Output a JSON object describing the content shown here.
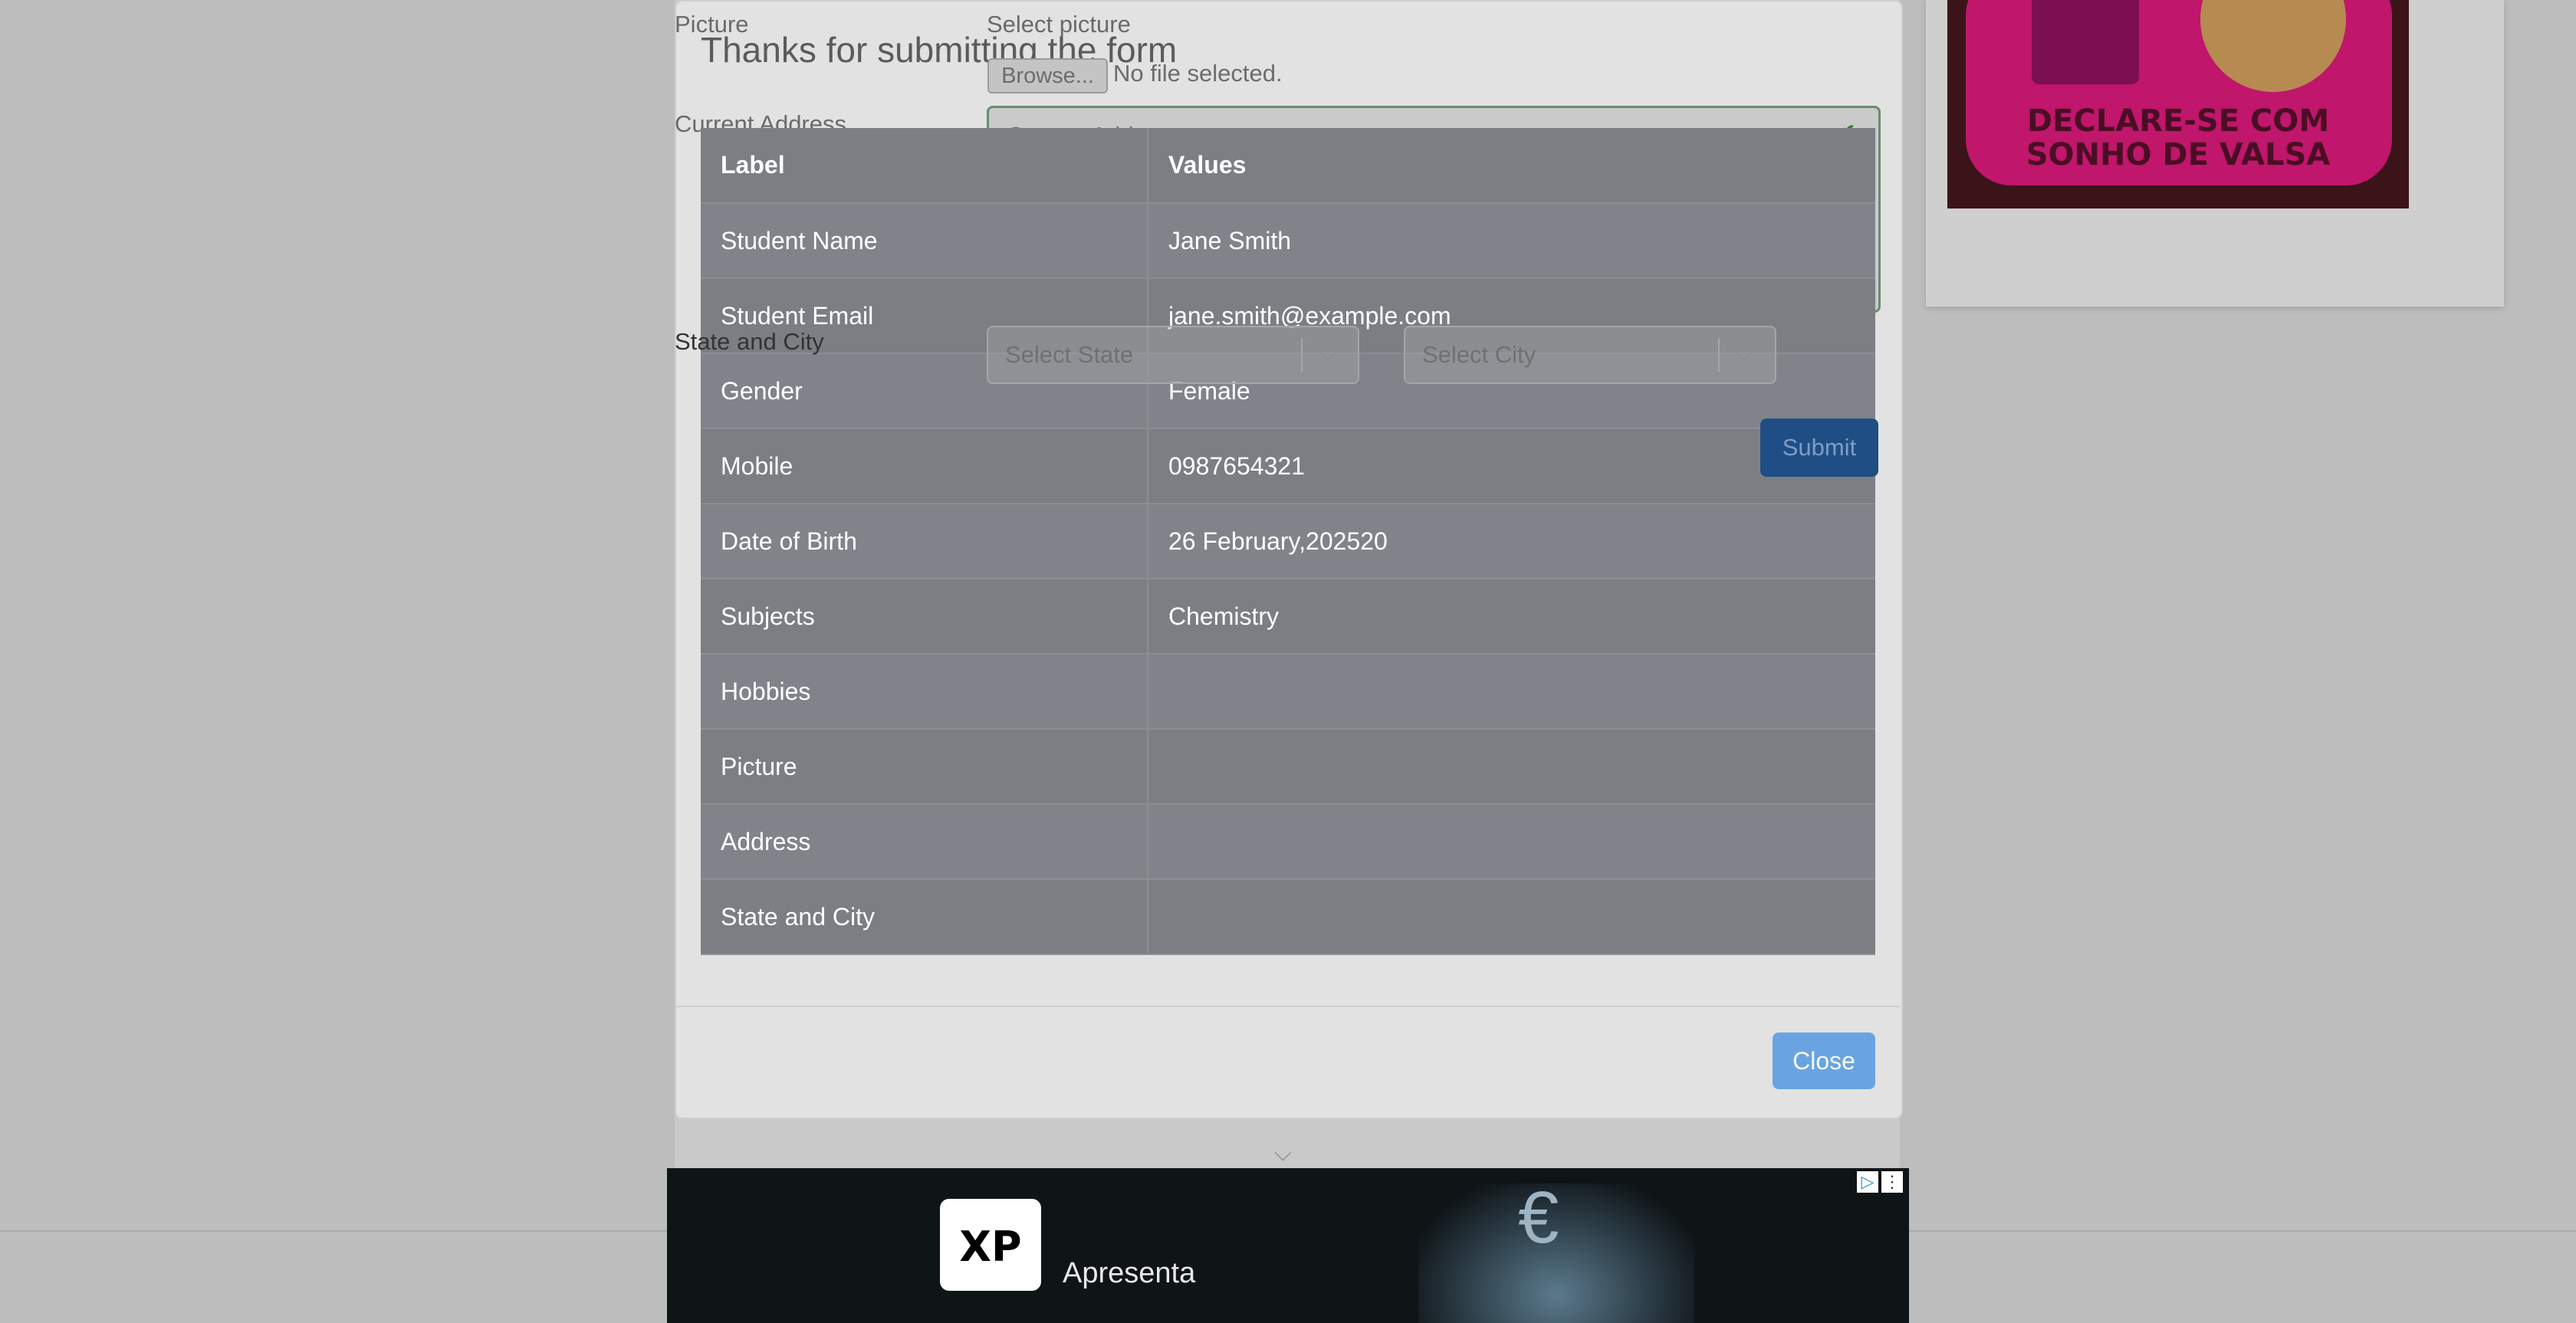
{
  "form": {
    "picture_label": "Picture",
    "select_picture_label": "Select picture",
    "browse_label": "Browse...",
    "file_status": "No file selected.",
    "current_address_label": "Current Address",
    "current_address_placeholder": "Current Address",
    "state_city_label": "State and City",
    "state_placeholder": "Select State",
    "city_placeholder": "Select City",
    "submit_label": "Submit"
  },
  "modal": {
    "title": "Thanks for submitting the form",
    "table": {
      "headers": [
        "Label",
        "Values"
      ],
      "rows": [
        {
          "label": "Student Name",
          "value": "Jane Smith"
        },
        {
          "label": "Student Email",
          "value": "jane.smith@example.com"
        },
        {
          "label": "Gender",
          "value": "Female"
        },
        {
          "label": "Mobile",
          "value": "0987654321"
        },
        {
          "label": "Date of Birth",
          "value": "26 February,202520"
        },
        {
          "label": "Subjects",
          "value": "Chemistry"
        },
        {
          "label": "Hobbies",
          "value": ""
        },
        {
          "label": "Picture",
          "value": ""
        },
        {
          "label": "Address",
          "value": ""
        },
        {
          "label": "State and City",
          "value": ""
        }
      ]
    },
    "close_label": "Close"
  },
  "side_ad": {
    "headline_line1": "DECLARE-SE COM",
    "headline_line2": "SONHO DE VALSA",
    "colors": {
      "brand": "#c0166b",
      "text": "#4a0e24"
    }
  },
  "bottom_ad": {
    "logo_text": "XP",
    "tagline": "Apresenta",
    "icons": [
      "adchoices-icon",
      "ad-menu-icon",
      "euro-icon",
      "chevron-down-icon"
    ]
  }
}
